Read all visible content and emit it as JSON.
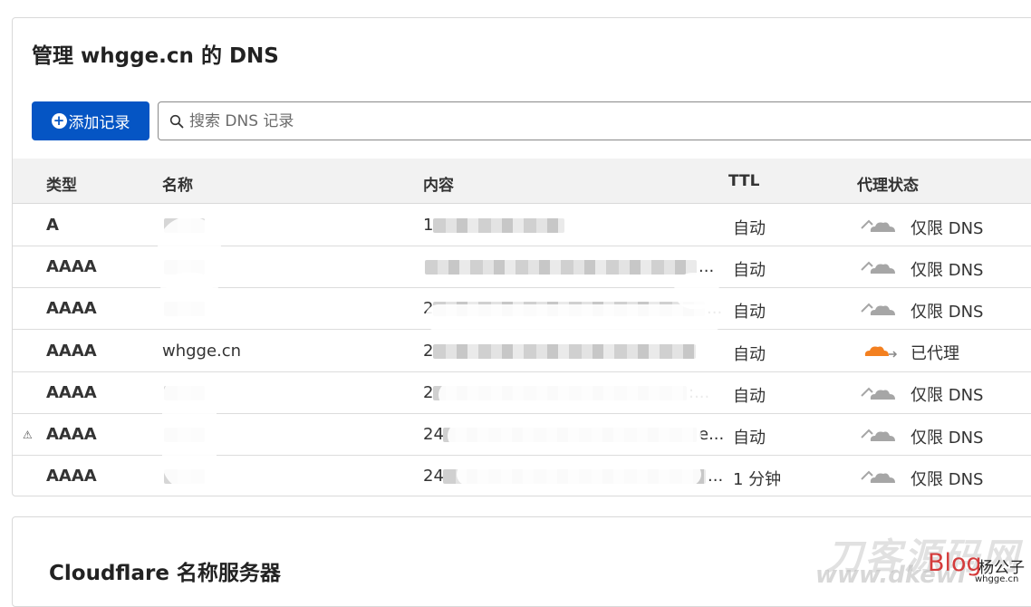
{
  "header": {
    "title_prefix": "管理",
    "domain": "whgge.cn",
    "title_suffix": "的 DNS"
  },
  "toolbar": {
    "add_label": "添加记录",
    "search_placeholder": "搜索 DNS 记录"
  },
  "table": {
    "columns": [
      "类型",
      "名称",
      "内容",
      "TTL",
      "代理状态"
    ],
    "rows": [
      {
        "type": "A",
        "name": "",
        "content_prefix": "1",
        "content_suffix": "",
        "ttl": "自动",
        "proxy": "仅限 DNS",
        "proxied": false,
        "warning": false
      },
      {
        "type": "AAAA",
        "name": "",
        "content_prefix": "",
        "content_suffix": "...",
        "ttl": "自动",
        "proxy": "仅限 DNS",
        "proxied": false,
        "warning": false
      },
      {
        "type": "AAAA",
        "name": "",
        "content_prefix": "2",
        "content_suffix": "...",
        "ttl": "自动",
        "proxy": "仅限 DNS",
        "proxied": false,
        "warning": false
      },
      {
        "type": "AAAA",
        "name": "whgge.cn",
        "content_prefix": "2",
        "content_suffix": "",
        "ttl": "自动",
        "proxy": "已代理",
        "proxied": true,
        "warning": false
      },
      {
        "type": "AAAA",
        "name": "",
        "content_prefix": "2",
        "content_suffix": ":...",
        "ttl": "自动",
        "proxy": "仅限 DNS",
        "proxied": false,
        "warning": false
      },
      {
        "type": "AAAA",
        "name": "",
        "content_prefix": "24",
        "content_suffix": "e...",
        "ttl": "自动",
        "proxy": "仅限 DNS",
        "proxied": false,
        "warning": true
      },
      {
        "type": "AAAA",
        "name": "",
        "content_prefix": "24",
        "content_suffix": "...",
        "ttl": "1 分钟",
        "proxy": "仅限 DNS",
        "proxied": false,
        "warning": false
      }
    ]
  },
  "nameservers": {
    "title": "Cloudflare 名称服务器"
  },
  "watermark": {
    "main": "刀客源码网",
    "url": "www.dkewl",
    "blog": "Blog",
    "name": "杨公子",
    "site": "whgge.cn"
  },
  "icons": {
    "warning": "warning-triangle-icon",
    "search": "search-icon",
    "add": "plus-circle-icon",
    "cloud_dns": "cloud-grey-icon",
    "cloud_proxied": "cloud-orange-icon"
  },
  "colors": {
    "primary": "#0555c4",
    "proxied_cloud": "#f38020",
    "dns_cloud": "#a6a6a6"
  }
}
